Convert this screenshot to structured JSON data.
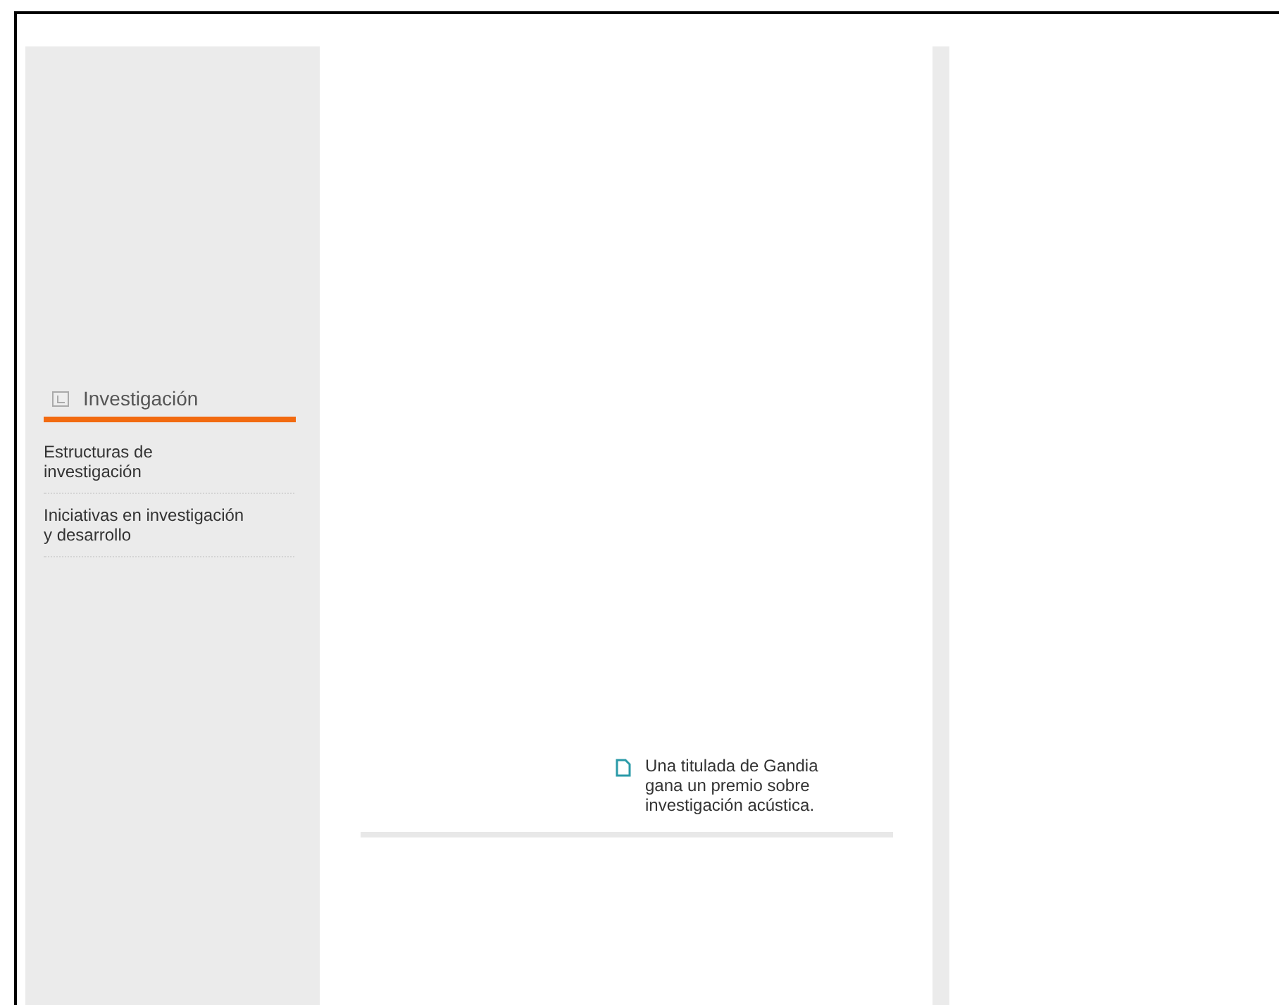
{
  "sidebar": {
    "heading": "Investigación",
    "items": [
      {
        "lines": [
          "Estructuras de",
          "investigación"
        ]
      },
      {
        "lines": [
          "Iniciativas en investigación",
          "y desarrollo"
        ]
      }
    ]
  },
  "news": [
    {
      "lines": [
        "Una titulada de Gandia",
        "gana un premio sobre",
        "investigación acústica."
      ]
    }
  ]
}
